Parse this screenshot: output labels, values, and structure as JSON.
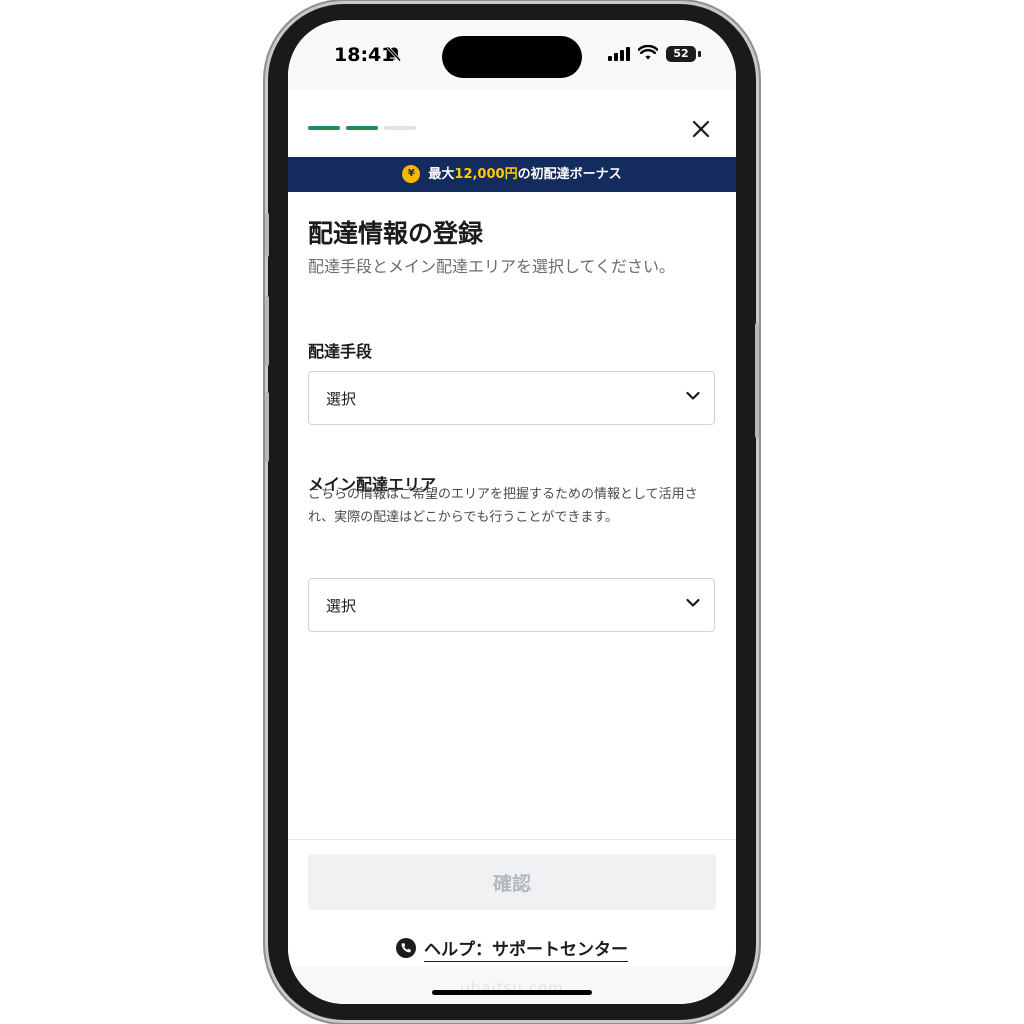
{
  "status_bar": {
    "time": "18:41",
    "battery": "52"
  },
  "header": {
    "progress": {
      "total_steps": 3,
      "completed_steps": 2,
      "active_color": "#1f8a52",
      "inactive_color": "#e3e3e6"
    },
    "close_icon": "close-icon"
  },
  "banner": {
    "prefix": "最大",
    "amount": "12,000円",
    "suffix": "の初配達ボーナス",
    "coin_symbol": "¥",
    "bg_color": "#142b5e",
    "amount_color": "#ffcc00"
  },
  "form": {
    "title": "配達情報の登録",
    "subtitle": "配達手段とメイン配達エリアを選択してください。",
    "delivery_method": {
      "label": "配達手段",
      "value": "選択"
    },
    "main_area": {
      "label": "メイン配達エリア",
      "note": "こちらの情報はご希望のエリアを把握するための情報として活用され、実際の配達はどこからでも行うことができます。",
      "value": "選択"
    }
  },
  "footer": {
    "confirm_label": "確認",
    "help_label": "ヘルプ：サポートセンター"
  },
  "watermark": "ubaitsu.com"
}
